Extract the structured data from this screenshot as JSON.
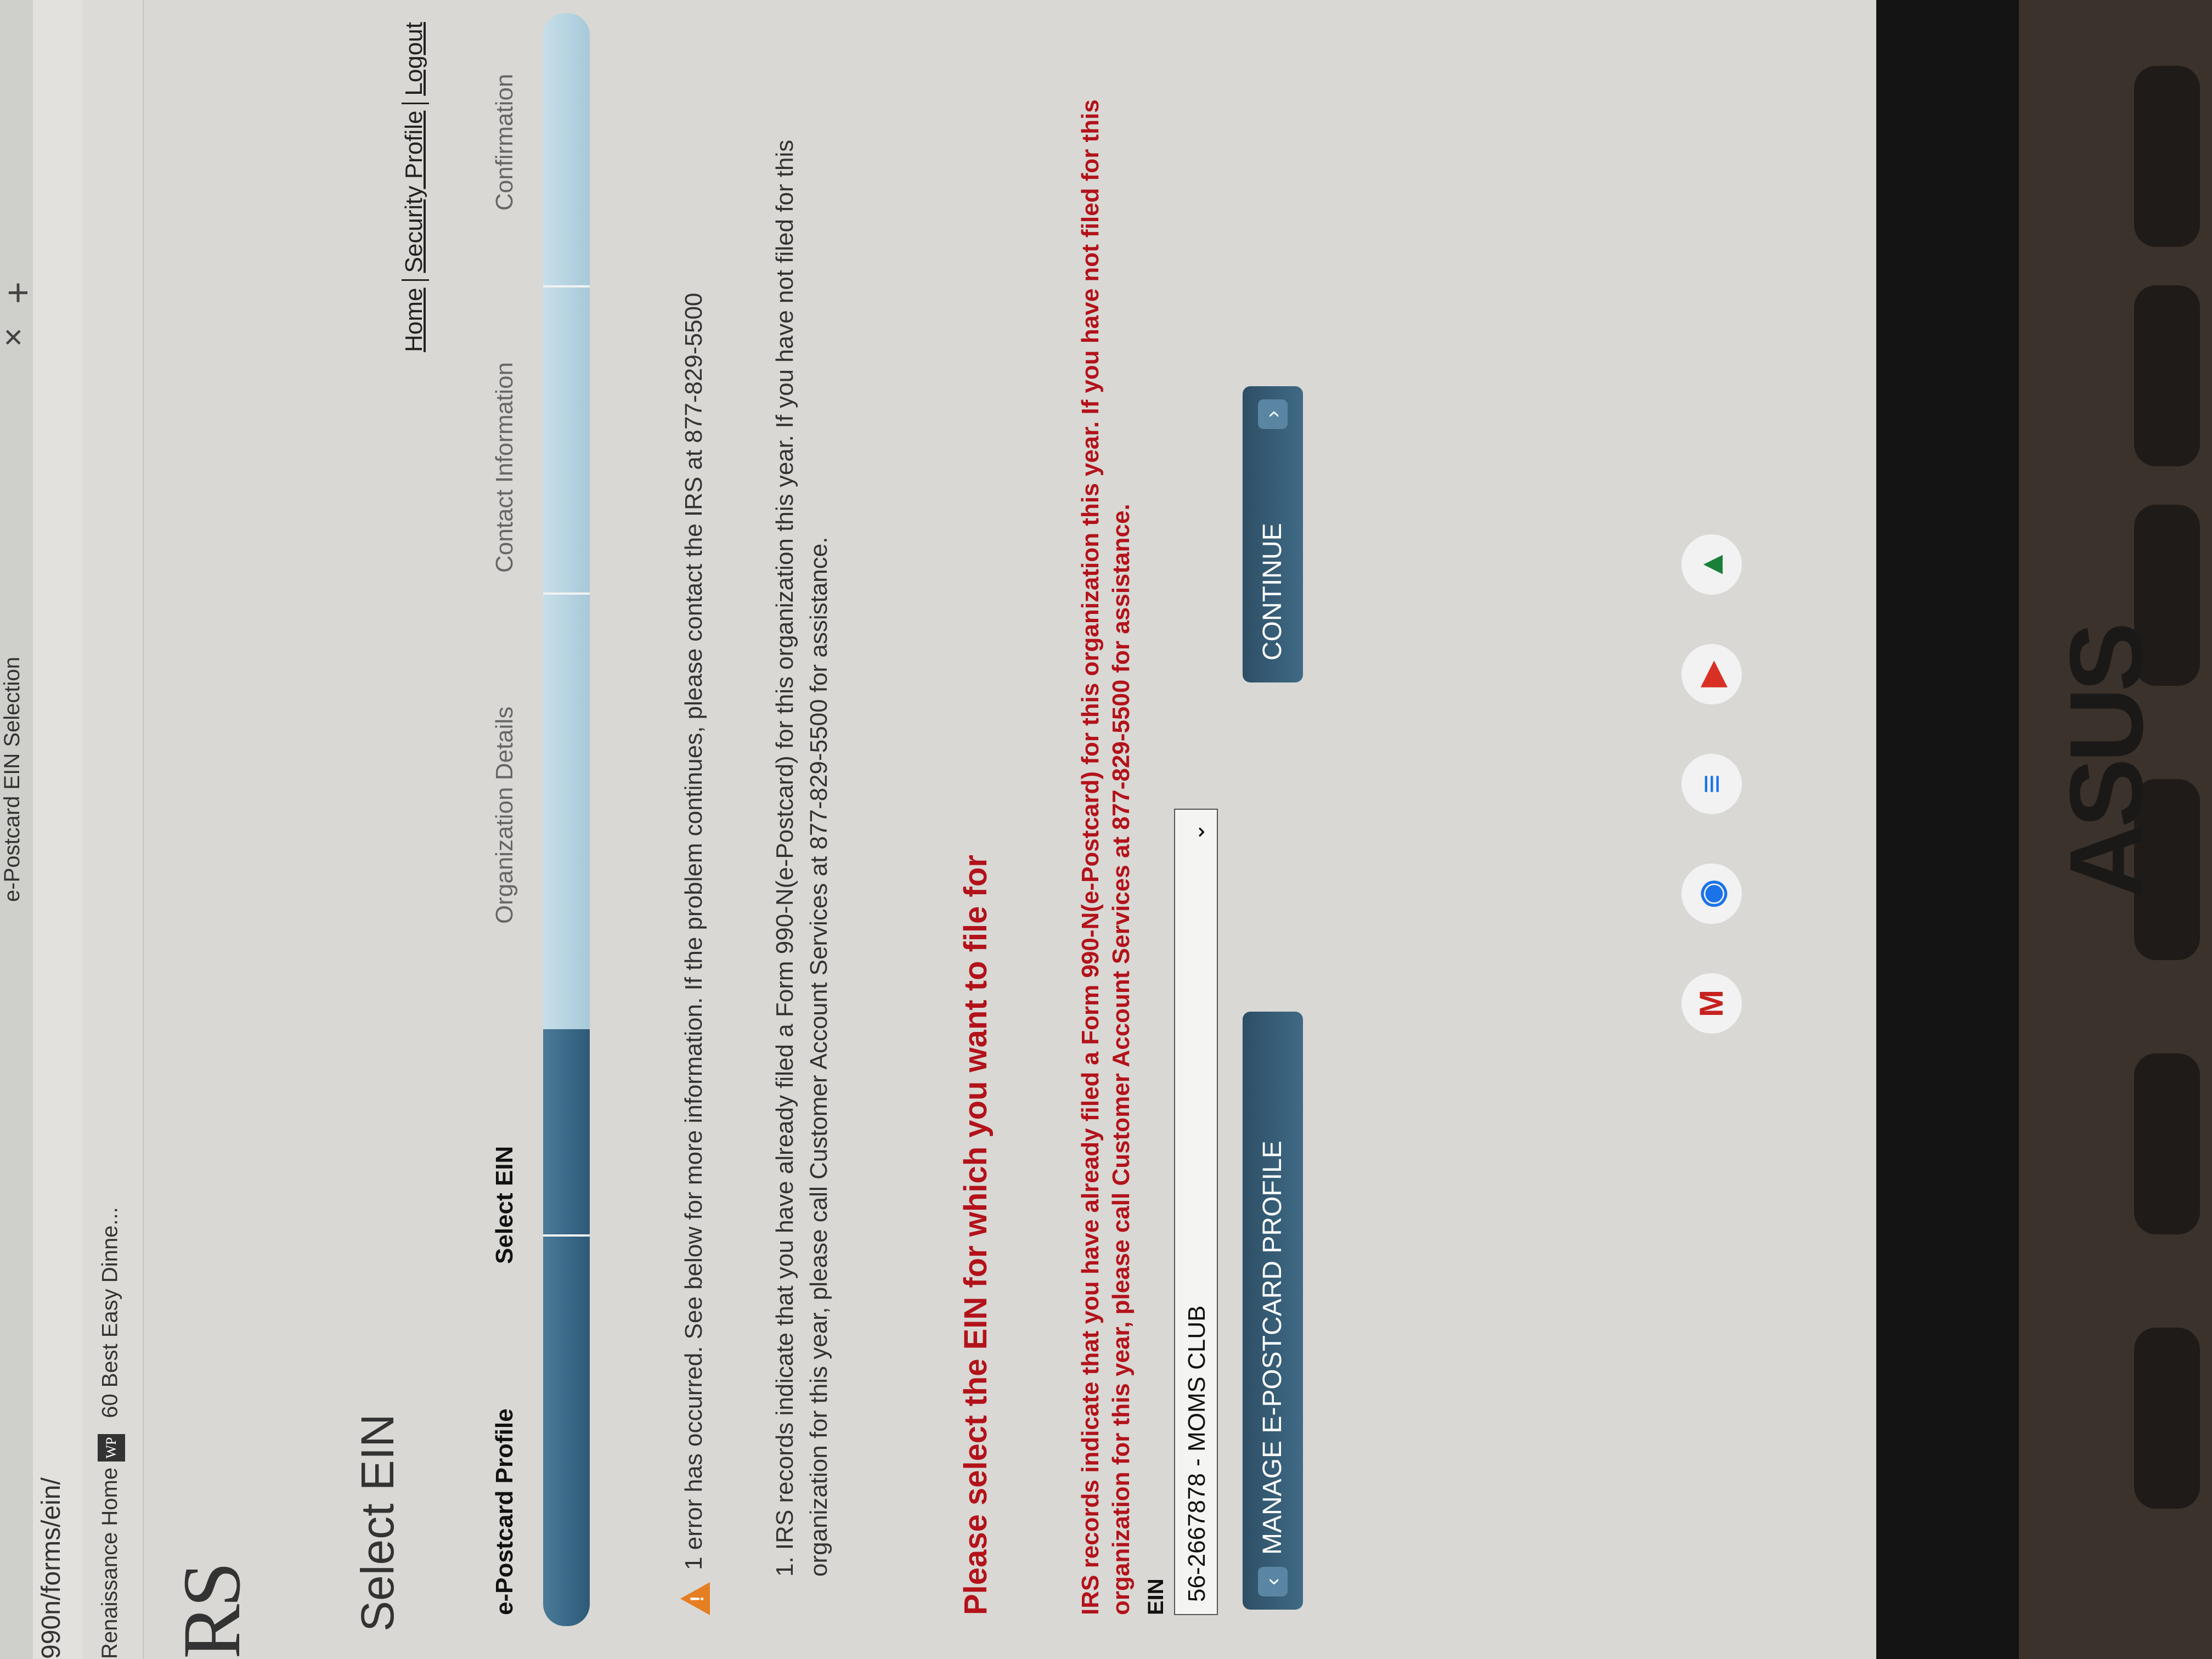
{
  "browser": {
    "tab_title": "e-Postcard EIN Selection",
    "url": "990n/forms/ein/",
    "bookmarks": [
      {
        "label": "Renaissance Home",
        "icon": "bookmark-icon"
      },
      {
        "label": "60 Best Easy Dinne...",
        "icon": "wp-icon",
        "icon_text": "WP"
      }
    ]
  },
  "page": {
    "logo": "RS",
    "title": "Select EIN",
    "top_links": {
      "home": "Home",
      "security_profile": "Security Profile",
      "logout": "Logout"
    },
    "steps": [
      {
        "label": "e-Postcard Profile",
        "state": "done"
      },
      {
        "label": "Select EIN",
        "state": "current"
      },
      {
        "label": "Organization Details",
        "state": "pending"
      },
      {
        "label": "Contact Information",
        "state": "pending"
      },
      {
        "label": "Confirmation",
        "state": "pending"
      }
    ],
    "progress_fraction": 0.37,
    "error_summary": "1 error has occurred. See below for more information. If the problem continues, please contact the IRS at 877-829-5500",
    "error_items": [
      "1. IRS records indicate that you have already filed a Form 990-N(e-Postcard) for this organization this year. If you have not filed for this organization for this year, please call Customer Account Services at 877-829-5500 for assistance."
    ],
    "select_heading": "Please select the EIN for which you want to file for",
    "field_error": "IRS records indicate that you have already filed a Form 990-N(e-Postcard) for this organization this year. If you have not filed for this organization for this year, please call Customer Account Services at 877-829-5500 for assistance.",
    "ein_label": "EIN",
    "ein_selected": "56-2667878 - MOMS CLUB",
    "buttons": {
      "manage": "MANAGE E-POSTCARD PROFILE",
      "continue": "CONTINUE"
    }
  },
  "shelf_apps": [
    "gmail-icon",
    "chrome-icon",
    "docs-icon",
    "youtube-icon",
    "drive-icon"
  ],
  "device_brand": "ASUS",
  "colors": {
    "error_red": "#b3121a",
    "button_blue": "#2e4f66",
    "progress_fill": "#2c5a79"
  }
}
